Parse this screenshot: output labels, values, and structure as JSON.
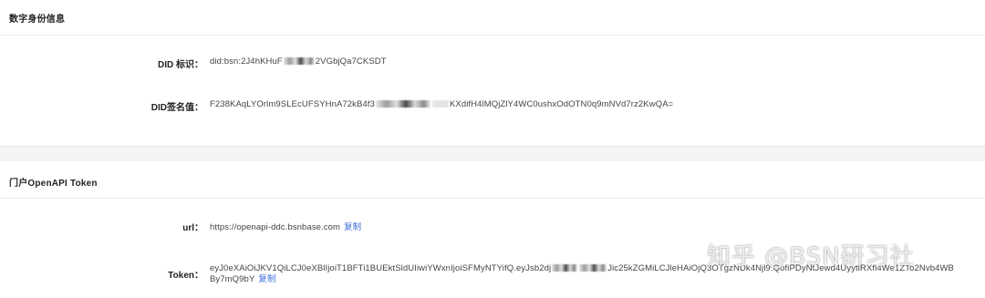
{
  "did_section": {
    "title": "数字身份信息",
    "did_label": "DID 标识：",
    "did_value_start": "did:bsn:2J4hKHuF",
    "did_value_end": "2VGbjQa7CKSDT",
    "sig_label": "DID签名值：",
    "sig_value_start": "F238KAqLYOrlm9SLEcUFSYHnA72kB4f3",
    "sig_value_end": "KXdifH4lMQjZlY4WC0ushxOdOTN0q9mNVd7rz2KwQA="
  },
  "token_section": {
    "title": "门户OpenAPI Token",
    "url_label": "url：",
    "url_value": "https://openapi-ddc.bsnbase.com",
    "url_copy": "复制",
    "token_label": "Token：",
    "token_line1_start": "eyJ0eXAiOiJKV1QiLCJ0eXBlIjoiT1BFTi1BUEktSldUIiwiYWxnIjoiSFMyNTYifQ.eyJsb2dj",
    "token_line1_end": "Jic25kZGMiLCJleHAiOjQ3OTgzNDk4Njl9.QofiPDyNtJewd4UyytlRXfl4We1ZTo2Nvb4WB",
    "token_line2": "By7mQ9bY",
    "token_copy": "复制"
  },
  "watermark": "知乎 @BSN研习社"
}
